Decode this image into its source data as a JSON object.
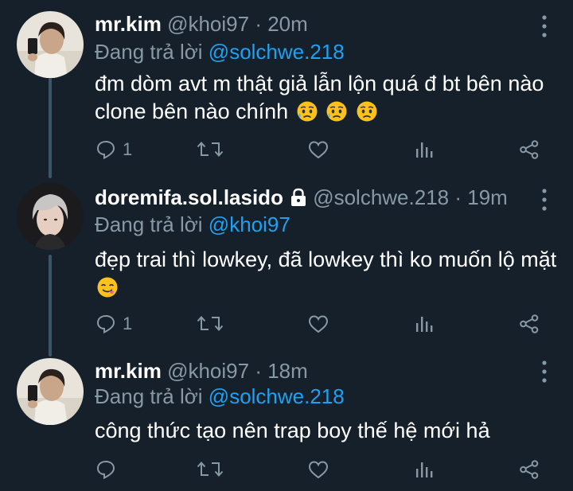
{
  "tweets": [
    {
      "display_name": "mr.kim",
      "handle": "@khoi97",
      "time_separator": "·",
      "time": "20m",
      "reply_prefix": "Đang trả lời",
      "reply_to": "@solchwe.218",
      "text": "đm dòm avt m thật giả lẫn lộn quá đ bt bên nào clone bên nào chính",
      "emojis": [
        "sad-sweat-emoji",
        "sad-sweat-emoji",
        "sad-emoji"
      ],
      "reply_count": "1",
      "protected": false
    },
    {
      "display_name": "doremifa.sol.lasido",
      "handle": "@solchwe.218",
      "time_separator": "·",
      "time": "19m",
      "reply_prefix": "Đang trả lời",
      "reply_to": "@khoi97",
      "text": "đẹp trai thì lowkey, đã lowkey thì ko muốn lộ mặt",
      "emojis": [
        "yum-emoji"
      ],
      "reply_count": "1",
      "protected": true
    },
    {
      "display_name": "mr.kim",
      "handle": "@khoi97",
      "time_separator": "·",
      "time": "18m",
      "reply_prefix": "Đang trả lời",
      "reply_to": "@solchwe.218",
      "text": "công thức tạo nên trap boy thế hệ mới hả",
      "emojis": [],
      "reply_count": "",
      "protected": false
    }
  ],
  "icons": {
    "reply": "reply-icon",
    "retweet": "retweet-icon",
    "like": "heart-icon",
    "analytics": "analytics-icon",
    "share": "share-icon",
    "more": "more-vertical-icon",
    "lock": "lock-icon"
  },
  "colors": {
    "background": "#15202b",
    "text": "#ffffff",
    "secondary": "#8899a6",
    "mention": "#1da1f2",
    "thread_line": "#3d5466"
  }
}
